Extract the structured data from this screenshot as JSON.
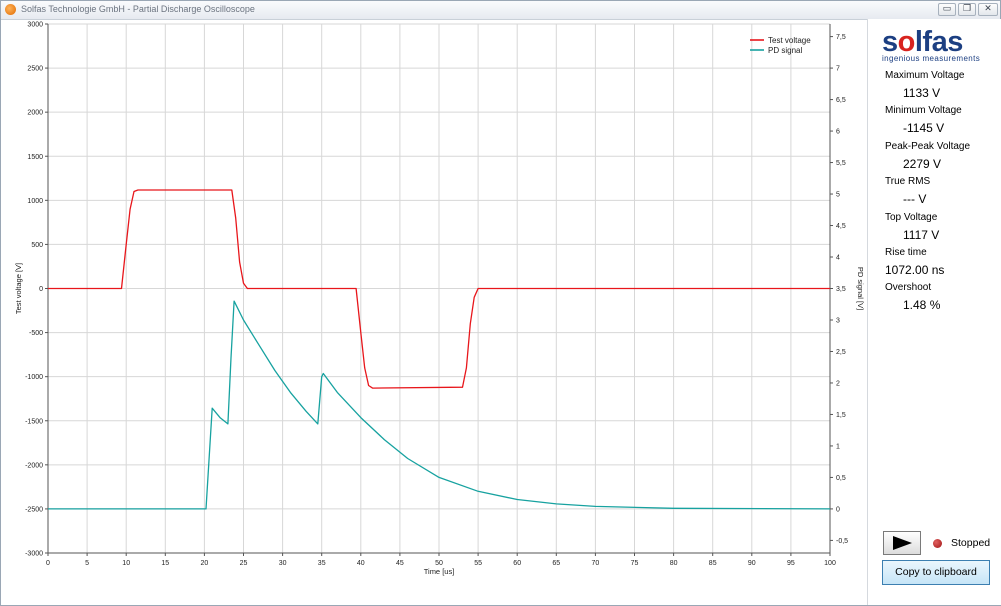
{
  "window": {
    "title": "Solfas Technologie GmbH - Partial Discharge Oscilloscope",
    "minimize_glyph": "▭",
    "maximize_glyph": "❐",
    "close_glyph": "✕"
  },
  "sidebar": {
    "logo_text_1": "s",
    "logo_text_o": "o",
    "logo_text_2": "lfas",
    "logo_subtitle": "ingenious measurements",
    "metrics": [
      {
        "label": "Maximum Voltage",
        "value": "1133 V"
      },
      {
        "label": "Minimum Voltage",
        "value": "-1145 V"
      },
      {
        "label": "Peak-Peak Voltage",
        "value": "2279 V"
      },
      {
        "label": "True RMS",
        "value": "--- V"
      },
      {
        "label": "Top Voltage",
        "value": "1117 V"
      },
      {
        "label": "Rise time",
        "value": "1072.00 ns"
      },
      {
        "label": "Overshoot",
        "value": "1.48 %"
      }
    ],
    "status": "Stopped",
    "copy_button": "Copy to clipboard",
    "play_icon": "play-icon"
  },
  "chart_data": {
    "type": "line",
    "title": "",
    "xlabel": "Time [us]",
    "ylabel_left": "Test voltage [V]",
    "ylabel_right": "PD signal [V]",
    "xlim": [
      0,
      100
    ],
    "ylim_left": [
      -3000,
      3000
    ],
    "ylim_right": [
      -0.7,
      7.7
    ],
    "grid": true,
    "legend_placement": "top-right",
    "x_ticks": [
      "0",
      "5",
      "10",
      "15",
      "20",
      "25",
      "30",
      "35",
      "40",
      "45",
      "50",
      "55",
      "60",
      "65",
      "70",
      "75",
      "80",
      "85",
      "90",
      "95",
      "100"
    ],
    "y_left_ticks": [
      "3000",
      "2500",
      "2000",
      "1500",
      "1000",
      "500",
      "0",
      "-500",
      "-1000",
      "-1500",
      "-2000",
      "-2500",
      "-3000"
    ],
    "y_right_ticks": [
      "7,5",
      "7",
      "6,5",
      "6",
      "5,5",
      "5",
      "4,5",
      "4",
      "3,5",
      "3",
      "2,5",
      "2",
      "1,5",
      "1",
      "0,5",
      "0",
      "-0,5"
    ],
    "y_right_tick_values": [
      7.5,
      7,
      6.5,
      6,
      5.5,
      5,
      4.5,
      4,
      3.5,
      3,
      2.5,
      2,
      1.5,
      1,
      0.5,
      0,
      -0.5
    ],
    "series": [
      {
        "name": "Test voltage",
        "axis": "left",
        "color": "#e8161b",
        "points": [
          [
            0,
            0
          ],
          [
            9.4,
            0
          ],
          [
            10,
            500
          ],
          [
            10.5,
            900
          ],
          [
            11,
            1100
          ],
          [
            11.5,
            1117
          ],
          [
            23.5,
            1117
          ],
          [
            24,
            800
          ],
          [
            24.5,
            300
          ],
          [
            25,
            60
          ],
          [
            25.5,
            0
          ],
          [
            39.4,
            0
          ],
          [
            40,
            -500
          ],
          [
            40.5,
            -900
          ],
          [
            41,
            -1100
          ],
          [
            41.5,
            -1130
          ],
          [
            53,
            -1120
          ],
          [
            53.5,
            -900
          ],
          [
            54,
            -400
          ],
          [
            54.5,
            -100
          ],
          [
            55,
            0
          ],
          [
            100,
            0
          ]
        ]
      },
      {
        "name": "PD signal",
        "axis": "right",
        "color": "#17a2a0",
        "points": [
          [
            0,
            0
          ],
          [
            20.2,
            0
          ],
          [
            20.6,
            0.8
          ],
          [
            21,
            1.6
          ],
          [
            22,
            1.45
          ],
          [
            23,
            1.35
          ],
          [
            23.4,
            2.4
          ],
          [
            23.8,
            3.3
          ],
          [
            25,
            3
          ],
          [
            27,
            2.6
          ],
          [
            29,
            2.2
          ],
          [
            31,
            1.85
          ],
          [
            33,
            1.55
          ],
          [
            34.5,
            1.35
          ],
          [
            35,
            2.1
          ],
          [
            35.2,
            2.15
          ],
          [
            37,
            1.85
          ],
          [
            40,
            1.45
          ],
          [
            43,
            1.1
          ],
          [
            46,
            0.8
          ],
          [
            50,
            0.5
          ],
          [
            55,
            0.28
          ],
          [
            60,
            0.15
          ],
          [
            65,
            0.08
          ],
          [
            70,
            0.04
          ],
          [
            80,
            0.01
          ],
          [
            100,
            0
          ]
        ]
      }
    ]
  }
}
